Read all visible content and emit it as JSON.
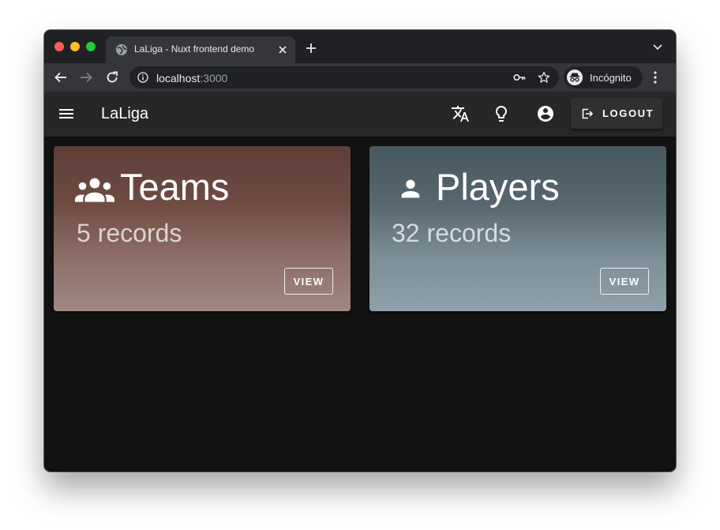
{
  "browser": {
    "tab": {
      "title": "LaLiga - Nuxt frontend demo",
      "favicon": "globe-icon"
    },
    "address": {
      "host": "localhost",
      "port": ":3000"
    },
    "profile_label": "Incógnito"
  },
  "appbar": {
    "title": "LaLiga",
    "icons": [
      "translate-icon",
      "lightbulb-icon",
      "account-circle-icon"
    ],
    "logout_label": "LOGOUT"
  },
  "cards": [
    {
      "icon": "account-group-icon",
      "title": "Teams",
      "records": "5 records",
      "action_label": "VIEW"
    },
    {
      "icon": "account-icon",
      "title": "Players",
      "records": "32 records",
      "action_label": "VIEW"
    }
  ],
  "colors": {
    "app_background": "#121212",
    "appbar": "#272727",
    "teams_card_top": "#5d3e37",
    "teams_card_bottom": "#a18883",
    "players_card_top": "#485861",
    "players_card_bottom": "#8ea1aa"
  }
}
